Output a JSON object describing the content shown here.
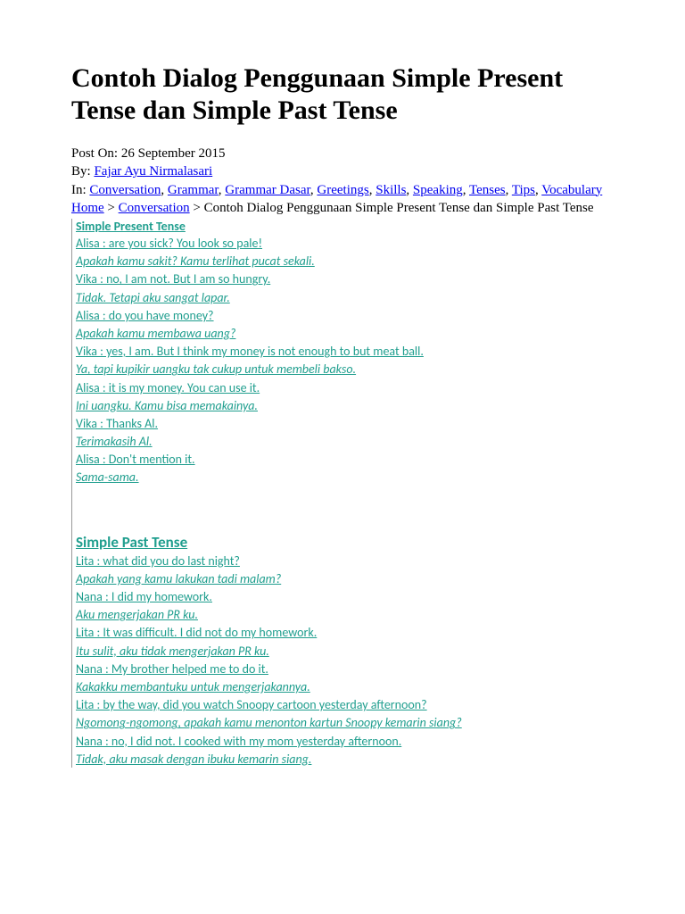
{
  "title": "Contoh Dialog Penggunaan Simple Present Tense dan Simple Past Tense",
  "postOn": "Post On: 26 September 2015",
  "byLabel": "By: ",
  "author": "Fajar Ayu Nirmalasari",
  "inLabel": "In: ",
  "categories": {
    "c0": "Conversation",
    "c1": "Grammar",
    "c2": "Grammar Dasar",
    "c3": "Greetings",
    "c4": "Skills",
    "c5": "Speaking",
    "c6": "Tenses",
    "c7": "Tips",
    "c8": "Vocabulary"
  },
  "breadcrumb": {
    "home": "Home",
    "section": "Conversation",
    "current": "Contoh Dialog Penggunaan Simple Present Tense dan Simple Past Tense"
  },
  "section1": {
    "title": "Simple Present Tense",
    "lines": {
      "l0": "Alisa : are you sick? You look so pale!",
      "t0": "Apakah kamu sakit? Kamu terlihat pucat sekali.",
      "l1": "Vika : no, I am not. But I am so hungry.",
      "t1": "Tidak. Tetapi aku sangat lapar.",
      "l2": "Alisa : do you have money?",
      "t2": "Apakah kamu membawa uang?",
      "l3": "Vika  : yes, I am. But I think my money is not enough to but meat ball.",
      "t3": "Ya, tapi kupikir uangku tak cukup untuk membeli bakso.",
      "l4": "Alisa : it is my money. You can use it.",
      "t4": "Ini uangku. Kamu bisa memakainya.",
      "l5": "Vika : Thanks Al.",
      "t5": "Terimakasih Al.",
      "l6": "Alisa : Don't mention it.",
      "t6": "Sama-sama."
    }
  },
  "section2": {
    "title": "Simple Past Tense",
    "lines": {
      "l0": "Lita   : what did you do last night?",
      "t0": "Apakah yang kamu lakukan tadi malam?",
      "l1": "Nana : I did my homework.",
      "t1": "Aku mengerjakan PR ku.",
      "l2": "Lita   : It was difficult. I did not do my homework.",
      "t2": "Itu sulit, aku tidak mengerjakan PR ku.",
      "l3": "Nana          : My brother helped me to do it.",
      "t3": "Kakakku membantuku untuk mengerjakannya.",
      "l4": "Lita   : by the way, did you watch Snoopy cartoon yesterday afternoon?",
      "t4": "Ngomong-ngomong, apakah kamu menonton kartun Snoopy kemarin siang?",
      "l5": "Nana : no, I did not. I cooked with my mom yesterday afternoon.",
      "t5": "Tidak, aku masak dengan ibuku kemarin siang."
    }
  }
}
